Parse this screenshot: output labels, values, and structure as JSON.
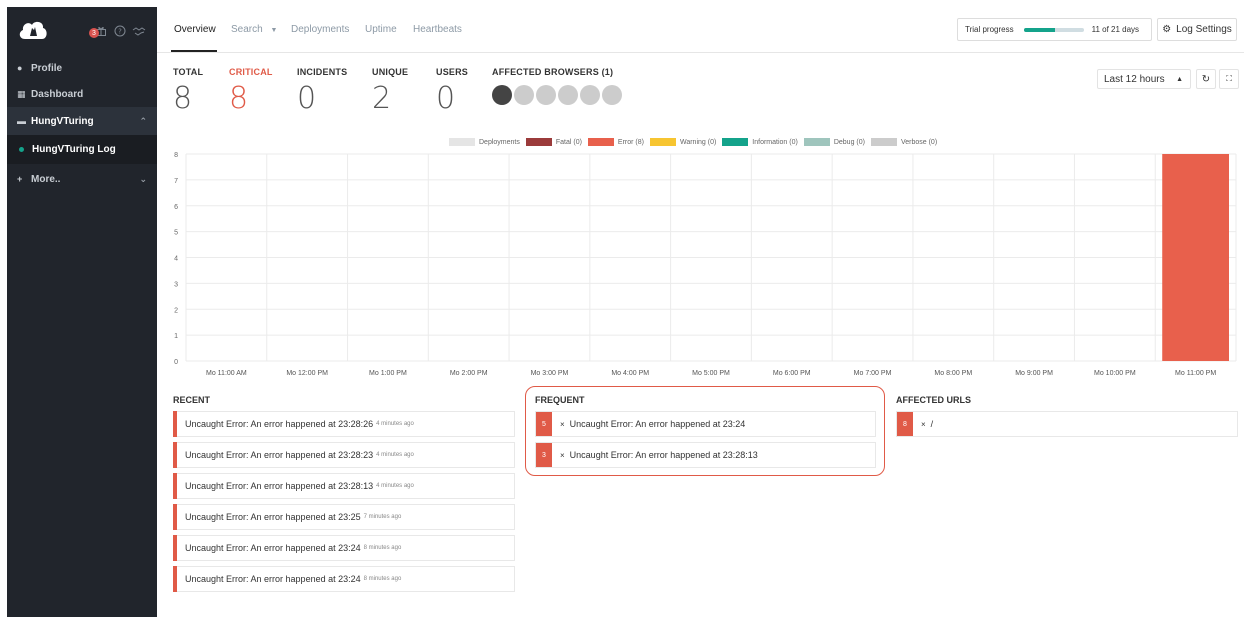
{
  "sidebar": {
    "notification_count": "3",
    "items": [
      {
        "label": "Profile"
      },
      {
        "label": "Dashboard"
      },
      {
        "label": "HungVTuring"
      },
      {
        "label": "HungVTuring Log"
      },
      {
        "label": "More.."
      }
    ]
  },
  "topnav": {
    "tabs": [
      {
        "label": "Overview"
      },
      {
        "label": "Search"
      },
      {
        "label": "Deployments"
      },
      {
        "label": "Uptime"
      },
      {
        "label": "Heartbeats"
      }
    ],
    "trial_label": "Trial progress",
    "trial_value": "11 of 21 days",
    "trial_fraction": 0.52,
    "log_settings": "Log Settings"
  },
  "stats": {
    "total_label": "TOTAL",
    "total": "8",
    "critical_label": "CRITICAL",
    "critical": "8",
    "incidents_label": "INCIDENTS",
    "incidents": "0",
    "unique_label": "UNIQUE",
    "unique": "2",
    "users_label": "USERS",
    "users": "0",
    "browsers_label": "AFFECTED BROWSERS (1)",
    "browser_icons": [
      "chrome-icon",
      "firefox-icon",
      "edge-icon",
      "ie-icon",
      "opera-icon",
      "safari-icon"
    ]
  },
  "controls": {
    "range": "Last 12 hours"
  },
  "chart_data": {
    "type": "bar",
    "categories": [
      "Mo 11:00 AM",
      "Mo 12:00 PM",
      "Mo 1:00 PM",
      "Mo 2:00 PM",
      "Mo 3:00 PM",
      "Mo 4:00 PM",
      "Mo 5:00 PM",
      "Mo 6:00 PM",
      "Mo 7:00 PM",
      "Mo 8:00 PM",
      "Mo 9:00 PM",
      "Mo 10:00 PM",
      "Mo 11:00 PM"
    ],
    "series": [
      {
        "name": "Deployments",
        "color": "#e5e5e5",
        "values": [
          0,
          0,
          0,
          0,
          0,
          0,
          0,
          0,
          0,
          0,
          0,
          0,
          0
        ]
      },
      {
        "name": "Fatal (0)",
        "color": "#9b3b3b",
        "values": [
          0,
          0,
          0,
          0,
          0,
          0,
          0,
          0,
          0,
          0,
          0,
          0,
          0
        ]
      },
      {
        "name": "Error (8)",
        "color": "#e8604c",
        "values": [
          0,
          0,
          0,
          0,
          0,
          0,
          0,
          0,
          0,
          0,
          0,
          0,
          8
        ]
      },
      {
        "name": "Warning (0)",
        "color": "#f7c531",
        "values": [
          0,
          0,
          0,
          0,
          0,
          0,
          0,
          0,
          0,
          0,
          0,
          0,
          0
        ]
      },
      {
        "name": "Information (0)",
        "color": "#14a38b",
        "values": [
          0,
          0,
          0,
          0,
          0,
          0,
          0,
          0,
          0,
          0,
          0,
          0,
          0
        ]
      },
      {
        "name": "Debug (0)",
        "color": "#9fc5bd",
        "values": [
          0,
          0,
          0,
          0,
          0,
          0,
          0,
          0,
          0,
          0,
          0,
          0,
          0
        ]
      },
      {
        "name": "Verbose (0)",
        "color": "#cccccc",
        "values": [
          0,
          0,
          0,
          0,
          0,
          0,
          0,
          0,
          0,
          0,
          0,
          0,
          0
        ]
      }
    ],
    "yticks": [
      0,
      1,
      2,
      3,
      4,
      5,
      6,
      7,
      8
    ],
    "ylim": [
      0,
      8
    ],
    "grid": true,
    "legend": "top"
  },
  "recent": {
    "title": "RECENT",
    "items": [
      {
        "text": "Uncaught Error: An error happened at 23:28:26",
        "ago": "4 minutes ago"
      },
      {
        "text": "Uncaught Error: An error happened at 23:28:23",
        "ago": "4 minutes ago"
      },
      {
        "text": "Uncaught Error: An error happened at 23:28:13",
        "ago": "4 minutes ago"
      },
      {
        "text": "Uncaught Error: An error happened at 23:25",
        "ago": "7 minutes ago"
      },
      {
        "text": "Uncaught Error: An error happened at 23:24",
        "ago": "8 minutes ago"
      },
      {
        "text": "Uncaught Error: An error happened at 23:24",
        "ago": "8 minutes ago"
      }
    ]
  },
  "frequent": {
    "title": "FREQUENT",
    "items": [
      {
        "count": "5",
        "text": "Uncaught Error: An error happened at 23:24"
      },
      {
        "count": "3",
        "text": "Uncaught Error: An error happened at 23:28:13"
      }
    ]
  },
  "urls": {
    "title": "AFFECTED URLS",
    "items": [
      {
        "count": "8",
        "text": "/"
      }
    ]
  },
  "colors": {
    "accent": "#14a38b",
    "error": "#e05a47",
    "sidebar": "#21252c"
  }
}
